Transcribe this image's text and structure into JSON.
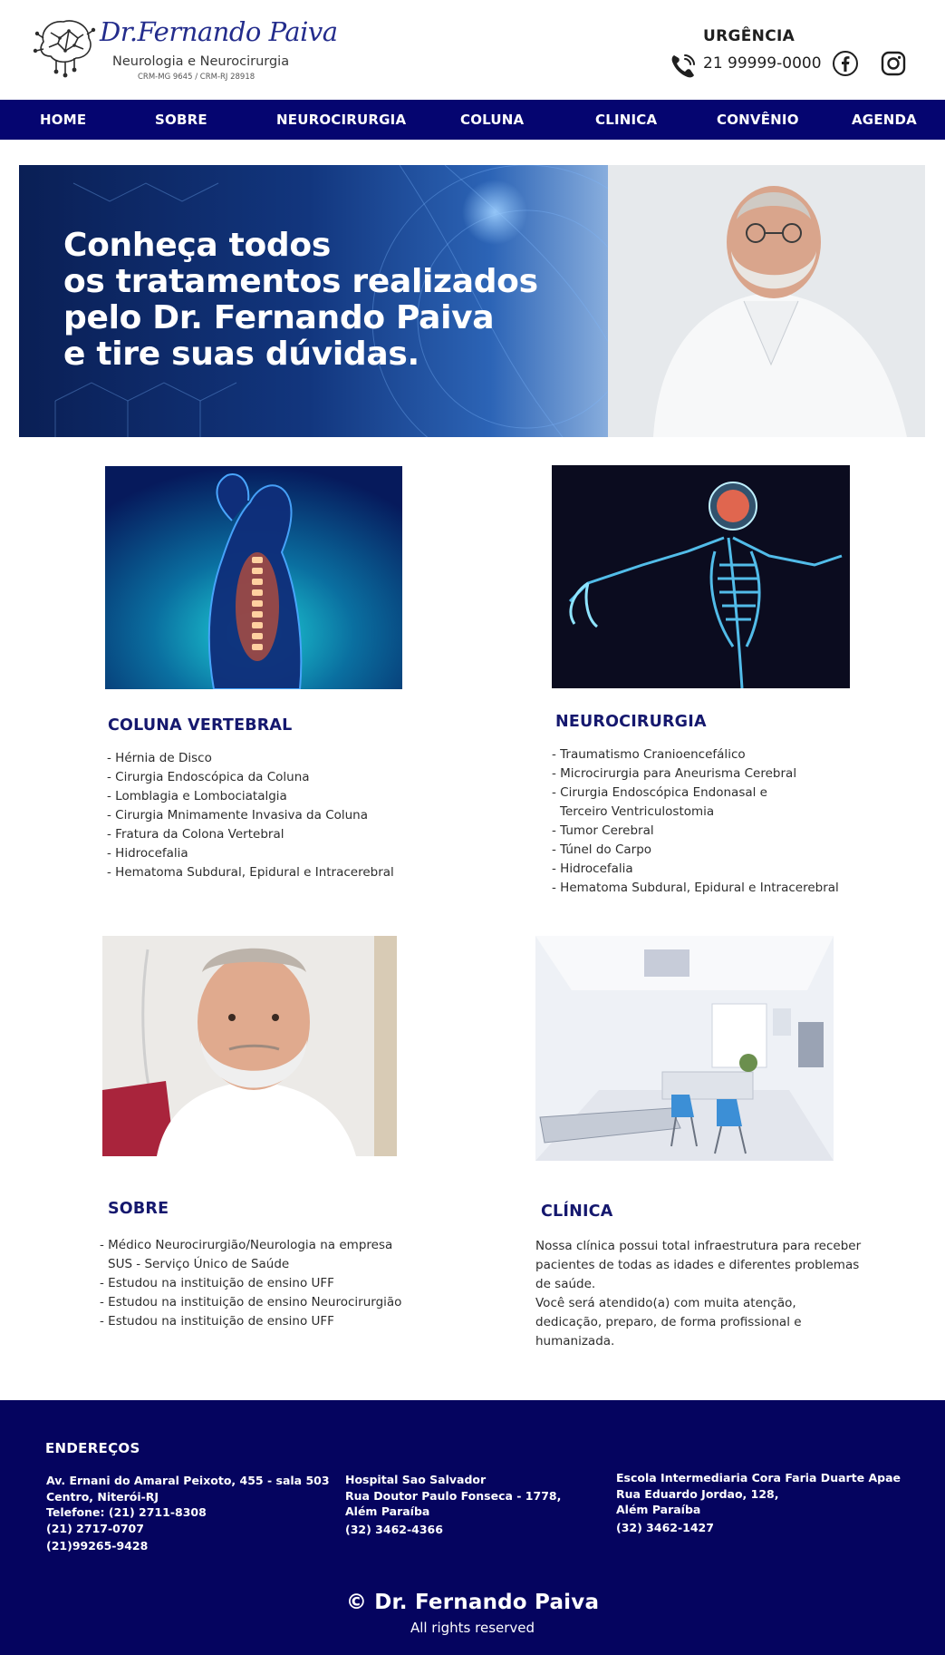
{
  "header": {
    "logo": {
      "name": "Dr.Fernando Paiva",
      "subtitle": "Neurologia e Neurocirurgia",
      "crm": "CRM-MG 9645 / CRM-RJ 28918"
    },
    "urgency_label": "URGÊNCIA",
    "urgency_phone": "21 99999-0000",
    "social": [
      "facebook-icon",
      "instagram-icon"
    ]
  },
  "nav": {
    "items": [
      {
        "label": "HOME"
      },
      {
        "label": "SOBRE"
      },
      {
        "label": "NEUROCIRURGIA"
      },
      {
        "label": "COLUNA"
      },
      {
        "label": "CLINICA"
      },
      {
        "label": "CONVÊNIO"
      },
      {
        "label": "AGENDA"
      }
    ]
  },
  "hero": {
    "lines": [
      "Conheça todos",
      "os tratamentos realizados",
      "pelo Dr. Fernando Paiva",
      "e tire suas dúvidas."
    ]
  },
  "cards": {
    "coluna": {
      "title": "COLUNA VERTEBRAL",
      "items": [
        "- Hérnia de Disco",
        "- Cirurgia Endoscópica da Coluna",
        "- Lomblagia e Lombociatalgia",
        "- Cirurgia Mnimamente Invasiva da Coluna",
        "- Fratura da Colona Vertebral",
        "- Hidrocefalia",
        "- Hematoma Subdural, Epidural e Intracerebral"
      ]
    },
    "neuro": {
      "title": "NEUROCIRURGIA",
      "items": [
        "- Traumatismo Cranioencefálico",
        "- Microcirurgia para Aneurisma Cerebral",
        "- Cirurgia Endoscópica Endonasal e",
        "Terceiro Ventriculostomia",
        "- Tumor Cerebral",
        "- Túnel do Carpo",
        "- Hidrocefalia",
        "- Hematoma Subdural, Epidural e Intracerebral"
      ]
    },
    "sobre": {
      "title": "SOBRE",
      "items": [
        "- Médico Neurocirurgião/Neurologia na empresa",
        "SUS - Serviço Único de Saúde",
        "- Estudou na instituição de ensino UFF",
        "- Estudou na instituição de ensino Neurocirurgião",
        "- Estudou na instituição de ensino UFF"
      ]
    },
    "clinica": {
      "title": "CLÍNICA",
      "text": "Nossa clínica possui total infraestrutura para receber pacientes de todas as idades e diferentes problemas de saúde.",
      "text2": "Você será atendido(a) com muita atenção, dedicação, preparo, de forma profissional e humanizada."
    }
  },
  "footer": {
    "title": "ENDEREÇOS",
    "addresses": [
      [
        "Av. Ernani do Amaral Peixoto, 455 - sala 503",
        "Centro, Niterói-RJ",
        "Telefone: (21) 2711-8308",
        "(21) 2717-0707",
        "(21)99265-9428"
      ],
      [
        "Hospital Sao Salvador",
        "Rua Doutor Paulo Fonseca - 1778,",
        "Além Paraíba",
        "(32) 3462-4366"
      ],
      [
        "Escola Intermediaria Cora Faria Duarte Apae",
        "Rua Eduardo Jordao, 128,",
        "Além Paraíba",
        "(32) 3462-1427"
      ]
    ],
    "copyright_symbol": "©",
    "copyright_name": "Dr. Fernando Paiva",
    "rights": "All rights reserved"
  },
  "colors": {
    "nav_bg": "#050570",
    "footer_bg": "#05045f",
    "title_blue": "#15186e",
    "logo_blue": "#232c8c"
  }
}
